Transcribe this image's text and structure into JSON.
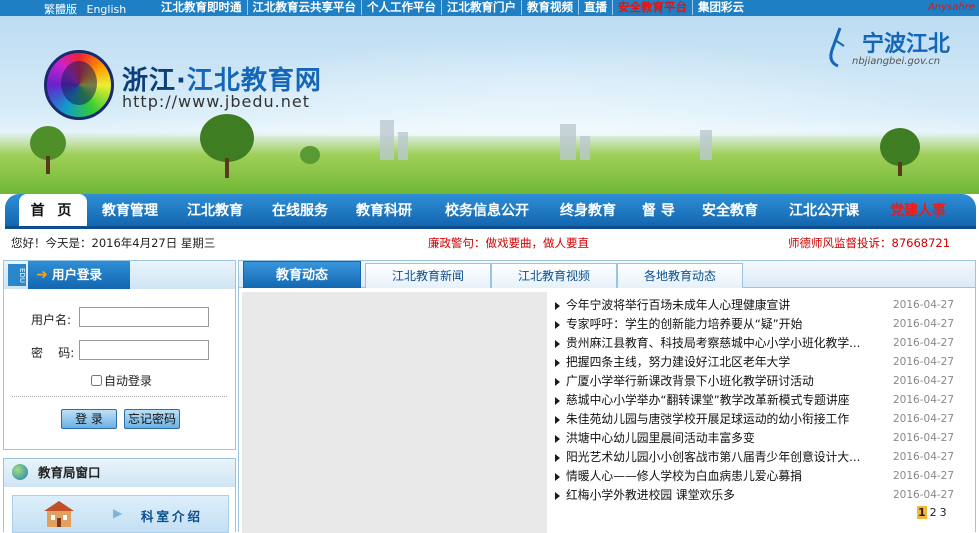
{
  "topbar": {
    "lang": [
      "繁體版",
      "English"
    ],
    "links": [
      "江北教育即时通",
      "江北教育云共享平台",
      "个人工作平台",
      "江北教育门户",
      "教育视频",
      "直播",
      "安全教育平台",
      "集团彩云"
    ],
    "user": "Anysahre"
  },
  "banner": {
    "site_title_a": "浙江·",
    "site_title_b": "江北教育网",
    "site_url": "http://www.jbedu.net",
    "gov_title": "宁波江北",
    "gov_url": "nbjiangbei.gov.cn"
  },
  "nav": {
    "items": [
      "首 页",
      "教育管理",
      "江北教育",
      "在线服务",
      "教育科研",
      "校务信息公开",
      "终身教育",
      "督 导",
      "安全教育",
      "江北公开课",
      "党建人事"
    ]
  },
  "info": {
    "date": "您好！今天是：2016年4月27日 星期三",
    "slogan": "廉政警句：做戏要曲，做人要直",
    "hotline": "师德师风监督投诉：87668721"
  },
  "login": {
    "edu": "EDU",
    "title": "用户登录",
    "username_label": "用户名:",
    "password_label": "密    码:",
    "auto_login": "自动登录",
    "login_button": "登 录",
    "forgot_button": "忘记密码"
  },
  "bureau": {
    "title": "教育局窗口",
    "room": "科室介绍"
  },
  "news": {
    "tabs": [
      "教育动态",
      "江北教育新闻",
      "江北教育视频",
      "各地教育动态"
    ],
    "items": [
      {
        "title": "今年宁波将举行百场未成年人心理健康宣讲",
        "date": "2016-04-27"
      },
      {
        "title": "专家呼吁：学生的创新能力培养要从“疑”开始",
        "date": "2016-04-27"
      },
      {
        "title": "贵州麻江县教育、科技局考察慈城中心小学小班化教学...",
        "date": "2016-04-27"
      },
      {
        "title": "把握四条主线，努力建设好江北区老年大学",
        "date": "2016-04-27"
      },
      {
        "title": "广厦小学举行新课改背景下小班化教学研讨活动",
        "date": "2016-04-27"
      },
      {
        "title": "慈城中心小学举办“翻转课堂”教学改革新模式专题讲座",
        "date": "2016-04-27"
      },
      {
        "title": "朱佳苑幼儿园与唐弢学校开展足球运动的幼小衔接工作",
        "date": "2016-04-27"
      },
      {
        "title": "洪塘中心幼儿园里晨间活动丰富多变",
        "date": "2016-04-27"
      },
      {
        "title": "阳光艺术幼儿园小小创客战市第八届青少年创意设计大...",
        "date": "2016-04-27"
      },
      {
        "title": "情暖人心——修人学校为白血病患儿爱心募捐",
        "date": "2016-04-27"
      },
      {
        "title": "红梅小学外教进校园 课堂欢乐多",
        "date": "2016-04-27"
      }
    ],
    "pages": [
      "1",
      "2",
      "3"
    ]
  }
}
